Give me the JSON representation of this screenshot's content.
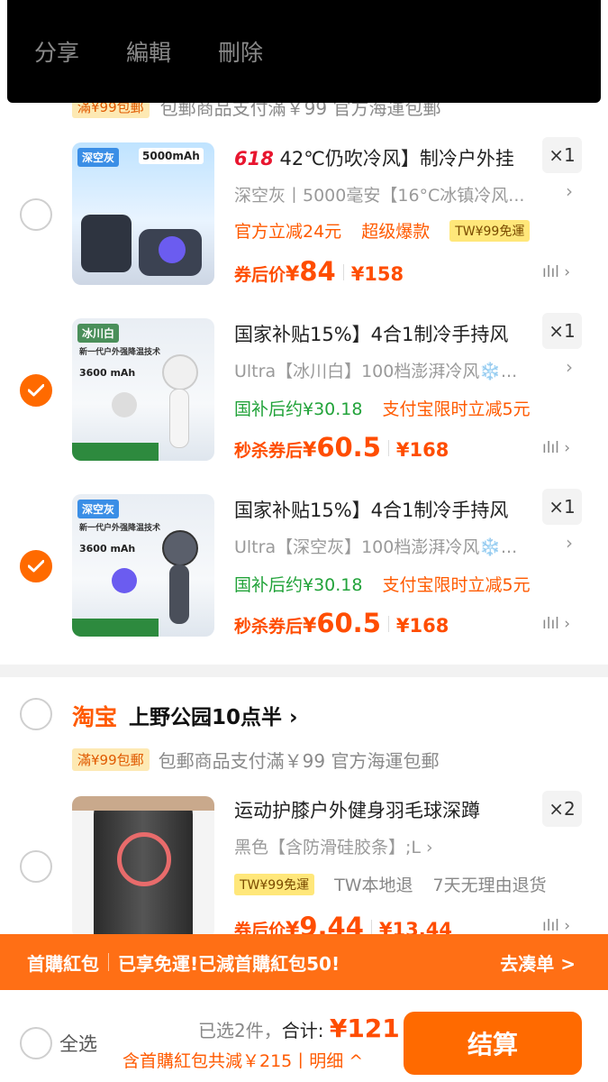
{
  "top_menu": {
    "share": "分享",
    "edit": "編輯",
    "delete": "刪除"
  },
  "peek_row": {
    "free_tag": "滿¥99包郵",
    "text": "包郵商品支付滿￥99 官方海運包郵"
  },
  "items": [
    {
      "checked": false,
      "title_prefix": "618",
      "title": "42℃仍吹冷风】制冷户外挂",
      "qty": "×1",
      "sku": "深空灰丨5000毫安【16°C冰镇冷风...",
      "promos": [
        "官方立减24元",
        "超级爆款"
      ],
      "promo_badge": "TW¥99免運",
      "price_label": "券后价",
      "price_currency": "¥",
      "price": "84",
      "orig_price": "¥158",
      "thumb_text": [
        "深空灰",
        "5000mAh"
      ]
    },
    {
      "checked": true,
      "title": "国家补贴15%】4合1制冷手持风",
      "qty": "×1",
      "sku": "Ultra【冰川白】100档澎湃冷风❄️...",
      "promos": [
        "国补后约¥30.18",
        "支付宝限时立减5元"
      ],
      "price_label": "秒杀券后",
      "price_currency": "¥",
      "price": "60.5",
      "orig_price": "¥168",
      "thumb_text": [
        "冰川白",
        "新一代户外强降温技术",
        "3600 mAh"
      ]
    },
    {
      "checked": true,
      "title": "国家补贴15%】4合1制冷手持风",
      "qty": "×1",
      "sku": "Ultra【深空灰】100档澎湃冷风❄️...",
      "promos": [
        "国补后约¥30.18",
        "支付宝限时立减5元"
      ],
      "price_label": "秒杀券后",
      "price_currency": "¥",
      "price": "60.5",
      "orig_price": "¥168",
      "thumb_text": [
        "深空灰",
        "新一代户外强降温技术",
        "3600 mAh"
      ]
    }
  ],
  "shop": {
    "platform": "淘宝",
    "name": "上野公园10点半",
    "free_tag": "滿¥99包郵",
    "note": "包郵商品支付滿￥99 官方海運包郵"
  },
  "knee_item": {
    "checked": false,
    "title": "运动护膝户外健身羽毛球深蹲",
    "qty": "×2",
    "sku": "黑色【含防滑硅胶条】;L",
    "badge": "TW¥99免運",
    "promos": [
      "TW本地退",
      "7天无理由退货"
    ],
    "price_label": "券后价",
    "price_currency": "¥",
    "price": "9.44",
    "orig_price": "¥13.44"
  },
  "banner": {
    "title": "首購紅包",
    "message": "已享免運!已減首購紅包50!",
    "action": "去凑单 >"
  },
  "footer": {
    "select_all": "全选",
    "selected": "已选2件，",
    "total_label": "合计:",
    "total": "¥121",
    "discount": "含首購紅包共減￥215丨明细 ^",
    "checkout": "结算"
  },
  "colors": {
    "accent": "#ff6a00",
    "price": "#ff4d00",
    "green": "#22a33a"
  }
}
